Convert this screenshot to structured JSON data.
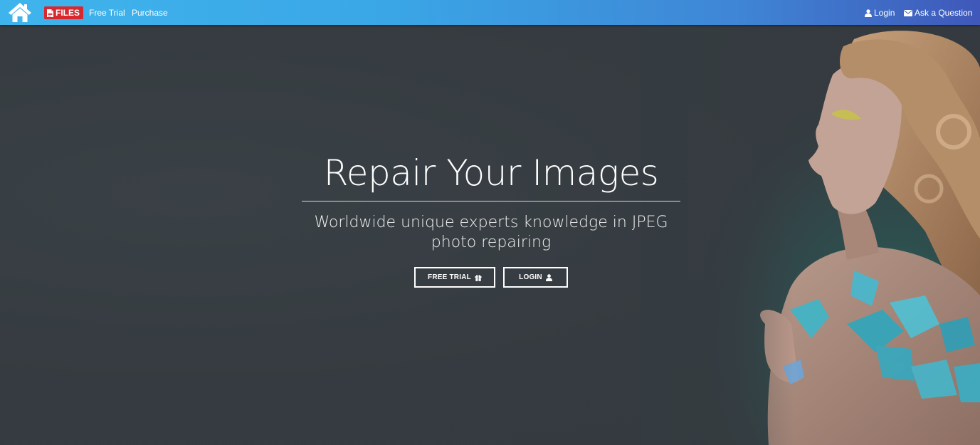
{
  "navbar": {
    "home_icon": "home-icon",
    "files_label": "FILES",
    "files_icon": "file-pdf-icon",
    "links": {
      "free_trial": "Free Trial",
      "purchase": "Purchase"
    },
    "right": {
      "login": "Login",
      "login_icon": "user-icon",
      "ask": "Ask a Question",
      "ask_icon": "envelope-icon"
    },
    "colors": {
      "gradient_start": "#3fb4ec",
      "gradient_end": "#3f58b9",
      "files_badge": "#d9272e"
    }
  },
  "hero": {
    "title": "Repair Your Images",
    "subtitle": "Worldwide unique experts knowledge in JPEG photo repairing",
    "buttons": {
      "free_trial": "FREE TRIAL",
      "free_trial_icon": "gift-icon",
      "login": "LOGIN",
      "login_icon": "user-icon"
    },
    "background_color": "#353c41"
  }
}
